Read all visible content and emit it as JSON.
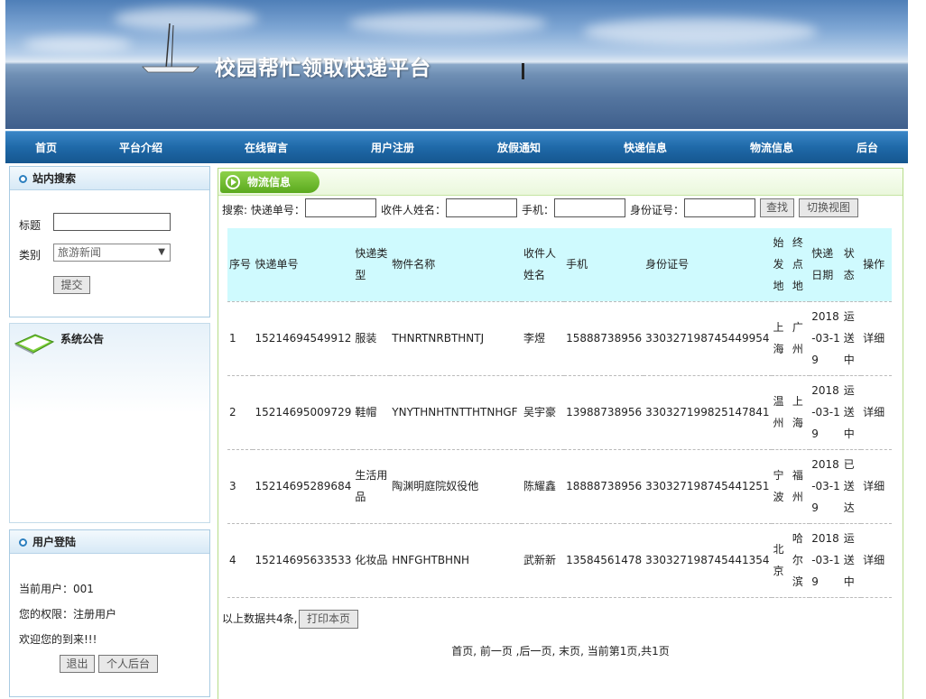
{
  "site": {
    "title": "校园帮忙领取快递平台"
  },
  "nav": [
    "首页",
    "平台介绍",
    "在线留言",
    "用户注册",
    "放假通知",
    "快递信息",
    "物流信息",
    "后台"
  ],
  "search_panel": {
    "title": "站内搜索",
    "title_label": "标题",
    "category_label": "类别",
    "category_value": "旅游新闻",
    "submit_label": "提交"
  },
  "notice_panel": {
    "title": "系统公告"
  },
  "login_panel": {
    "title": "用户登陆",
    "current_user": "当前用户：001",
    "permission": "您的权限：注册用户",
    "welcome": "欢迎您的到来!!!",
    "logout_label": "退出",
    "backend_label": "个人后台"
  },
  "main": {
    "tab_title": "物流信息",
    "search": {
      "prefix": "搜索: 快递单号：",
      "name_label": "收件人姓名：",
      "phone_label": "手机：",
      "id_label": "身份证号：",
      "find_label": "查找",
      "switch_label": "切换视图"
    },
    "table": {
      "headers": [
        "序号",
        "快递单号",
        "快递类型",
        "物件名称",
        "收件人姓名",
        "手机",
        "身份证号",
        "始发地",
        "终点地",
        "快递日期",
        "状态",
        "操作"
      ],
      "rows": [
        [
          "1",
          "15214694549912",
          "服装",
          "THNRTNRBTHNTJ",
          "李煜",
          "15888738956",
          "330327198745449954",
          "上海",
          "广州",
          "2018-03-19",
          "运送中",
          "详细"
        ],
        [
          "2",
          "15214695009729",
          "鞋帽",
          "YNYTHNHTNTTHTNHGF",
          "吴宇豪",
          "13988738956",
          "330327199825147841",
          "温州",
          "上海",
          "2018-03-19",
          "运送中",
          "详细"
        ],
        [
          "3",
          "15214695289684",
          "生活用品",
          "陶渊明庭院奴役他",
          "陈耀鑫",
          "18888738956",
          "330327198745441251",
          "宁波",
          "福州",
          "2018-03-19",
          "已送达",
          "详细"
        ],
        [
          "4",
          "15214695633533",
          "化妆品",
          "HNFGHTBHNH",
          "武新新",
          "13584561478",
          "330327198745441354",
          "北京",
          "哈尔滨",
          "2018-03-19",
          "运送中",
          "详细"
        ]
      ]
    },
    "count_text": "以上数据共4条,",
    "print_label": "打印本页",
    "pager_text": "首页, 前一页 ,后一页, 末页, 当前第1页,共1页"
  }
}
